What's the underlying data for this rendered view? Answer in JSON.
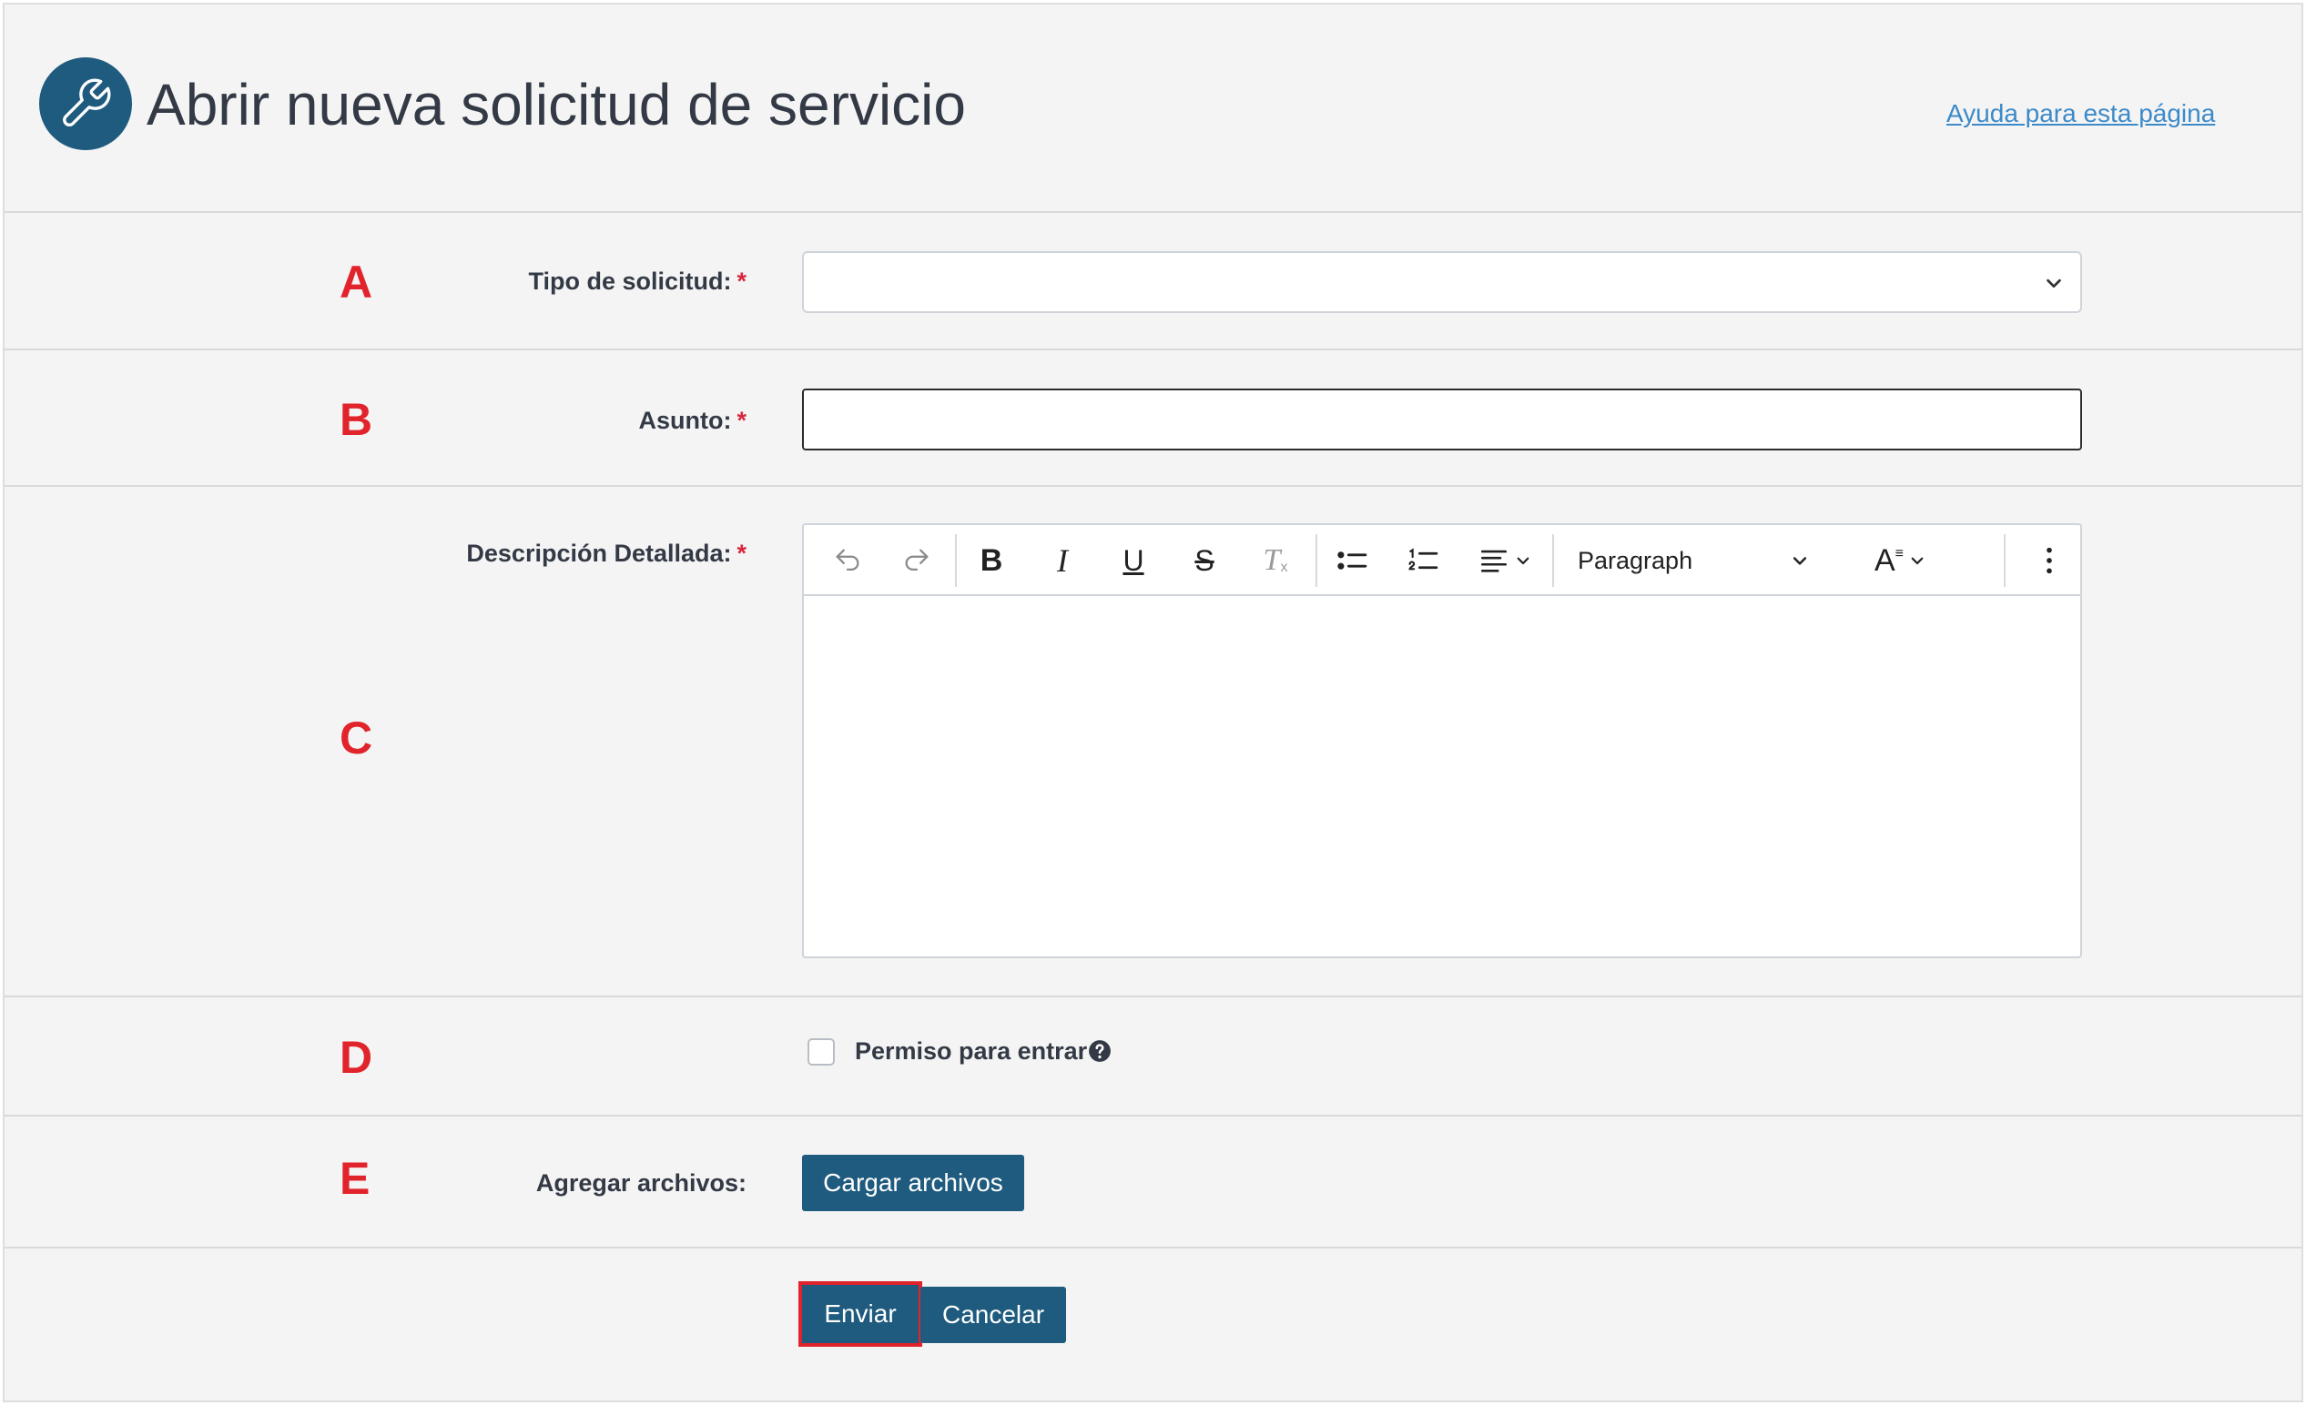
{
  "header": {
    "title": "Abrir nueva solicitud de servicio",
    "help_link": "Ayuda para esta página",
    "logo_icon": "wrench-icon"
  },
  "form": {
    "request_type": {
      "marker": "A",
      "label": "Tipo de solicitud:",
      "required_mark": "*",
      "value": ""
    },
    "subject": {
      "marker": "B",
      "label": "Asunto:",
      "required_mark": "*",
      "value": ""
    },
    "description": {
      "marker": "C",
      "label": "Descripción Detallada:",
      "required_mark": "*",
      "toolbar": {
        "undo_icon": "undo-icon",
        "redo_icon": "redo-icon",
        "bold_icon": "bold-icon",
        "italic_icon": "italic-icon",
        "underline_icon": "underline-icon",
        "strikethrough_icon": "strikethrough-icon",
        "clear_format_icon": "clear-formatting-icon",
        "bullet_list_icon": "bullet-list-icon",
        "numbered_list_icon": "numbered-list-icon",
        "align_icon": "align-left-icon",
        "block_format": "Paragraph",
        "text_style_icon": "text-style-icon",
        "more_icon": "more-vertical-icon"
      },
      "value": ""
    },
    "permission": {
      "marker": "D",
      "label": "Permiso para entrar",
      "checked": false
    },
    "attachments": {
      "marker": "E",
      "label": "Agregar archivos:",
      "upload_button": "Cargar archivos"
    },
    "actions": {
      "submit": "Enviar",
      "cancel": "Cancelar"
    }
  },
  "colors": {
    "primary": "#1f5b7e",
    "marker": "#e1232c",
    "required": "#d7263d",
    "link": "#3d8ac9",
    "background": "#f4f4f4"
  }
}
